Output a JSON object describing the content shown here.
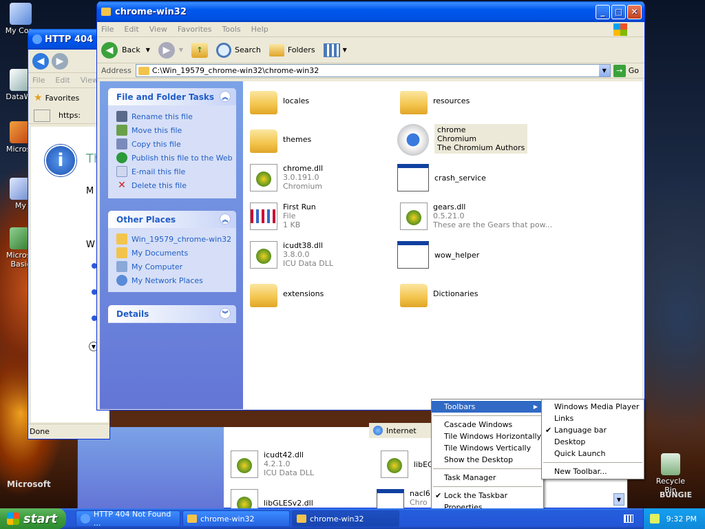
{
  "desktop": {
    "icons": [
      {
        "label": "My Com"
      },
      {
        "label": "DataWa"
      },
      {
        "label": "Microso"
      },
      {
        "label": "My"
      },
      {
        "label": "Microso Basic"
      },
      {
        "label": "Recycle Bin"
      }
    ],
    "brand_microsoft": "Microsoft",
    "brand_bungie": "BUNGIE"
  },
  "ie_window": {
    "title": "HTTP 404 N",
    "menu": [
      "File",
      "Edit",
      "View"
    ],
    "favorites_label": "Favorites",
    "address_partial": "https:",
    "status_text": "Done",
    "zone_text": "Internet",
    "page_partial_letters": [
      "Th",
      "M",
      "W"
    ]
  },
  "explorer": {
    "title": "chrome-win32",
    "menu": [
      "File",
      "Edit",
      "View",
      "Favorites",
      "Tools",
      "Help"
    ],
    "toolbar": {
      "back": "Back",
      "search": "Search",
      "folders": "Folders"
    },
    "address_label": "Address",
    "address_value": "C:\\Win_19579_chrome-win32\\chrome-win32",
    "go_label": "Go",
    "tasks_panel": {
      "header": "File and Folder Tasks",
      "items": [
        "Rename this file",
        "Move this file",
        "Copy this file",
        "Publish this file to the Web",
        "E-mail this file",
        "Delete this file"
      ]
    },
    "places_panel": {
      "header": "Other Places",
      "items": [
        "Win_19579_chrome-win32",
        "My Documents",
        "My Computer",
        "My Network Places"
      ]
    },
    "details_panel": {
      "header": "Details"
    },
    "files": [
      {
        "name": "locales",
        "kind": "folder"
      },
      {
        "name": "resources",
        "kind": "folder"
      },
      {
        "name": "themes",
        "kind": "folder"
      },
      {
        "name": "chrome",
        "sub1": "Chromium",
        "sub2": "The Chromium Authors",
        "kind": "chrome"
      },
      {
        "name": "chrome.dll",
        "sub1": "3.0.191.0",
        "sub2": "Chromium",
        "kind": "dll"
      },
      {
        "name": "crash_service",
        "kind": "exe"
      },
      {
        "name": "First Run",
        "sub1": "File",
        "sub2": "1 KB",
        "kind": "doc"
      },
      {
        "name": "gears.dll",
        "sub1": "0.5.21.0",
        "sub2": "These are the Gears that pow...",
        "kind": "dll"
      },
      {
        "name": "icudt38.dll",
        "sub1": "3.8.0.0",
        "sub2": "ICU Data DLL",
        "kind": "dll"
      },
      {
        "name": "wow_helper",
        "kind": "exe"
      },
      {
        "name": "extensions",
        "kind": "folder"
      },
      {
        "name": "Dictionaries",
        "kind": "folder"
      }
    ]
  },
  "back_window": {
    "files": [
      {
        "name": "icudt42.dll",
        "sub1": "4.2.1.0",
        "sub2": "ICU Data DLL"
      },
      {
        "name": "libEGL"
      },
      {
        "name": "libGLESv2.dll"
      },
      {
        "name": "nacl6",
        "sub1": "Chro"
      }
    ]
  },
  "context_menu": {
    "items": [
      "Toolbars",
      "Cascade Windows",
      "Tile Windows Horizontally",
      "Tile Windows Vertically",
      "Show the Desktop",
      "Task Manager",
      "Lock the Taskbar",
      "Properties"
    ],
    "lock_check": "✔"
  },
  "toolbars_submenu": {
    "items": [
      "Windows Media Player",
      "Links",
      "Language bar",
      "Desktop",
      "Quick Launch",
      "New Toolbar..."
    ],
    "checked": "✔"
  },
  "taskbar": {
    "start_label": "start",
    "tasks": [
      "HTTP 404 Not Found ...",
      "chrome-win32",
      "chrome-win32"
    ],
    "clock": "9:32 PM"
  },
  "colors": {
    "xp_blue": "#0058ee",
    "task_blue": "#215dc6",
    "highlight": "#316ac5"
  }
}
